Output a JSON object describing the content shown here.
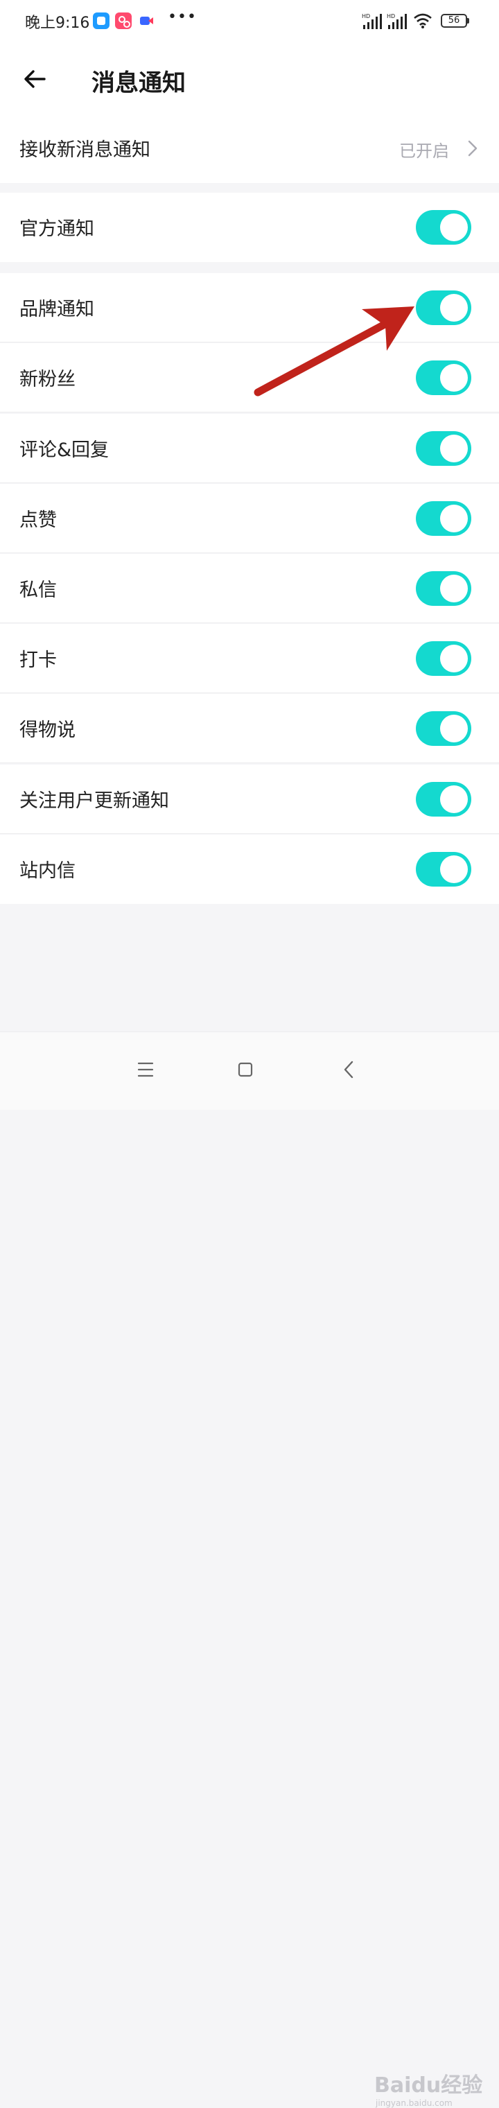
{
  "status_bar": {
    "time": "晚上9:16",
    "network_labels": [
      "HD",
      "HD"
    ],
    "battery": "56"
  },
  "header": {
    "title": "消息通知"
  },
  "receive_row": {
    "label": "接收新消息通知",
    "value": "已开启"
  },
  "settings": [
    {
      "label": "官方通知",
      "enabled": true
    },
    {
      "label": "品牌通知",
      "enabled": true
    },
    {
      "label": "新粉丝",
      "enabled": true
    },
    {
      "label": "评论&回复",
      "enabled": true
    },
    {
      "label": "点赞",
      "enabled": true
    },
    {
      "label": "私信",
      "enabled": true
    },
    {
      "label": "打卡",
      "enabled": true
    },
    {
      "label": "得物说",
      "enabled": true
    },
    {
      "label": "关注用户更新通知",
      "enabled": true
    },
    {
      "label": "站内信",
      "enabled": true
    }
  ],
  "colors": {
    "toggle_on": "#14d9cf",
    "annotation_arrow": "#c0231b"
  },
  "watermark": {
    "main": "Baidu经验",
    "sub": "jingyan.baidu.com"
  }
}
